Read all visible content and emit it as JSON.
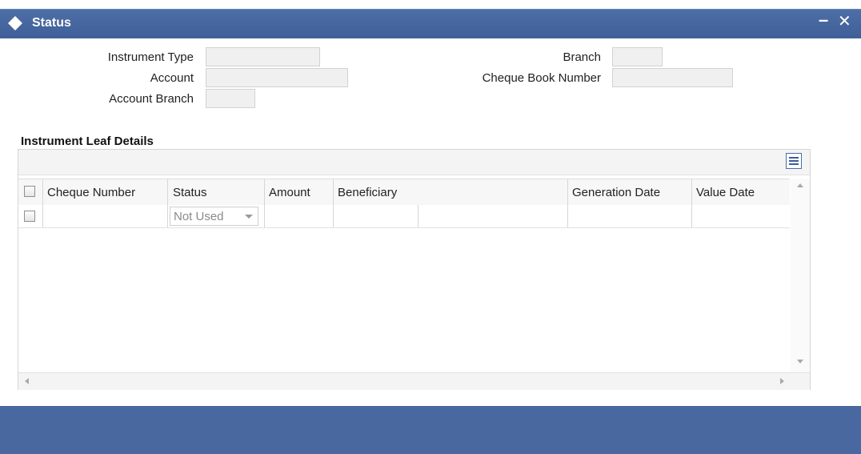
{
  "window": {
    "title": "Status",
    "minimize_symbol": "–",
    "close_symbol": "✕"
  },
  "form": {
    "instrument_type_label": "Instrument Type",
    "account_label": "Account",
    "account_branch_label": "Account Branch",
    "branch_label": "Branch",
    "cheque_book_number_label": "Cheque Book Number",
    "instrument_type_value": "",
    "account_value": "",
    "account_branch_value": "",
    "branch_value": "",
    "cheque_book_number_value": ""
  },
  "section": {
    "title": "Instrument Leaf Details"
  },
  "grid": {
    "columns": [
      "Cheque Number",
      "Status",
      "Amount",
      "Beneficiary",
      "Generation Date",
      "Value Date"
    ],
    "rows": [
      {
        "cheque_number": "",
        "status": "Not Used",
        "amount": "",
        "beneficiary": "",
        "generation_date": "",
        "value_date": ""
      }
    ]
  },
  "colors": {
    "titlebar": "#4a68a0",
    "footer": "#4a68a0",
    "field_bg": "#f0f0f0"
  },
  "icons": [
    "diamond-icon",
    "minimize-icon",
    "close-icon",
    "list-view-icon"
  ]
}
